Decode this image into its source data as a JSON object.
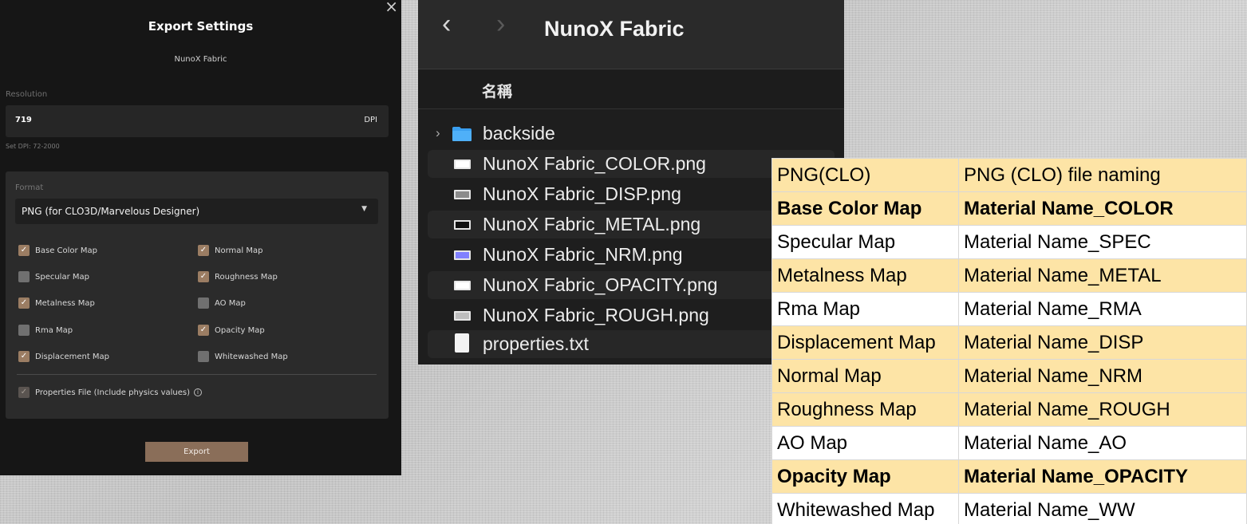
{
  "export_dialog": {
    "title": "Export Settings",
    "subtitle": "NunoX Fabric",
    "close_glyph": "×",
    "resolution": {
      "label": "Resolution",
      "value": "719",
      "unit": "DPI",
      "hint": "Set DPI: 72-2000"
    },
    "format": {
      "label": "Format",
      "selected": "PNG (for CLO3D/Marvelous Designer)",
      "caret_icon": "caret-down-icon"
    },
    "maps": [
      {
        "label": "Base Color Map",
        "checked": true
      },
      {
        "label": "Normal Map",
        "checked": true
      },
      {
        "label": "Specular Map",
        "checked": false
      },
      {
        "label": "Roughness Map",
        "checked": true
      },
      {
        "label": "Metalness Map",
        "checked": true
      },
      {
        "label": "AO Map",
        "checked": false
      },
      {
        "label": "Rma Map",
        "checked": false
      },
      {
        "label": "Opacity Map",
        "checked": true
      },
      {
        "label": "Displacement Map",
        "checked": true
      },
      {
        "label": "Whitewashed Map",
        "checked": false
      }
    ],
    "properties": {
      "label": "Properties File (Include physics values)",
      "checked": true,
      "info_icon": "info-icon"
    },
    "export_label": "Export",
    "colors": {
      "accent": "#8a6e59",
      "checkbox_on": "#9b7d63",
      "panel_bg": "#161616"
    }
  },
  "finder": {
    "title": "NunoX Fabric",
    "back_glyph": "‹",
    "forward_glyph": "›",
    "column_header": "名稱",
    "items": [
      {
        "name": "backside",
        "icon": "folder-icon"
      },
      {
        "name": "NunoX Fabric_COLOR.png",
        "icon": "image-file-icon"
      },
      {
        "name": "NunoX Fabric_DISP.png",
        "icon": "image-file-icon"
      },
      {
        "name": "NunoX Fabric_METAL.png",
        "icon": "image-file-icon"
      },
      {
        "name": "NunoX Fabric_NRM.png",
        "icon": "image-file-icon"
      },
      {
        "name": "NunoX Fabric_OPACITY.png",
        "icon": "image-file-icon"
      },
      {
        "name": "NunoX Fabric_ROUGH.png",
        "icon": "image-file-icon"
      },
      {
        "name": "properties.txt",
        "icon": "text-file-icon"
      }
    ],
    "thumb_colors": [
      "#ffffff",
      "#8c8c8c",
      "#111111",
      "#8080ff",
      "#ffffff",
      "#bdbdbd"
    ]
  },
  "naming_table": {
    "rows": [
      {
        "map": "PNG(CLO)",
        "name": "PNG (CLO) file naming",
        "bold": false,
        "highlight": true
      },
      {
        "map": "Base Color Map",
        "name": "Material Name_COLOR",
        "bold": true,
        "highlight": true
      },
      {
        "map": "Specular Map",
        "name": "Material Name_SPEC",
        "bold": false,
        "highlight": false
      },
      {
        "map": "Metalness Map",
        "name": "Material Name_METAL",
        "bold": false,
        "highlight": true
      },
      {
        "map": "Rma Map",
        "name": "Material Name_RMA",
        "bold": false,
        "highlight": false
      },
      {
        "map": "Displacement Map",
        "name": "Material Name_DISP",
        "bold": false,
        "highlight": true
      },
      {
        "map": "Normal Map",
        "name": "Material Name_NRM",
        "bold": false,
        "highlight": true
      },
      {
        "map": "Roughness Map",
        "name": "Material Name_ROUGH",
        "bold": false,
        "highlight": true
      },
      {
        "map": "AO Map",
        "name": "Material Name_AO",
        "bold": false,
        "highlight": false
      },
      {
        "map": "Opacity Map",
        "name": "Material Name_OPACITY",
        "bold": true,
        "highlight": true
      },
      {
        "map": "Whitewashed Map",
        "name": "Material Name_WW",
        "bold": false,
        "highlight": false
      }
    ],
    "highlight_color": "#fde4a6"
  }
}
